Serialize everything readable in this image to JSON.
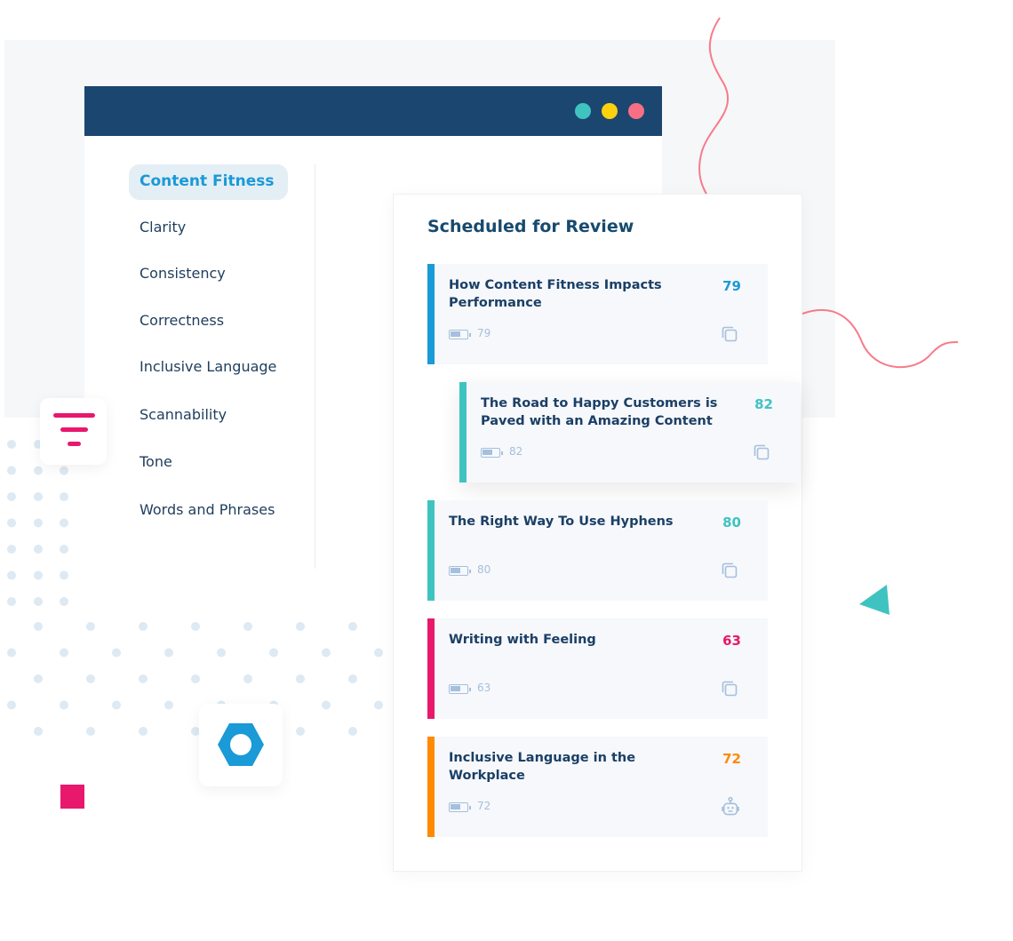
{
  "window": {
    "dots": [
      "#3fc3c1",
      "#fcd20f",
      "#f66f84"
    ]
  },
  "sidebar": {
    "items": [
      {
        "label": "Content Fitness",
        "active": true
      },
      {
        "label": "Clarity"
      },
      {
        "label": "Consistency"
      },
      {
        "label": "Correctness"
      },
      {
        "label": "Inclusive Language"
      },
      {
        "label": "Scannability"
      },
      {
        "label": "Tone"
      },
      {
        "label": "Words and Phrases"
      }
    ]
  },
  "review": {
    "title": "Scheduled for Review",
    "items": [
      {
        "title": "How Content Fitness Impacts Performance",
        "score": "79",
        "sub": "79",
        "color": "#1a9ad6",
        "icon": "copy-icon"
      },
      {
        "title": "The Road to Happy Customers is Paved with an Amazing Content",
        "score": "82",
        "sub": "82",
        "color": "#3fc3c1",
        "icon": "copy-icon"
      },
      {
        "title": "The Right Way To Use Hyphens",
        "score": "80",
        "sub": "80",
        "color": "#3fc3c1",
        "icon": "copy-icon"
      },
      {
        "title": "Writing with Feeling",
        "score": "63",
        "sub": "63",
        "color": "#e8186d",
        "icon": "copy-icon"
      },
      {
        "title": "Inclusive Language in the Workplace",
        "score": "72",
        "sub": "72",
        "color": "#ff8a00",
        "icon": "robot-icon"
      }
    ]
  }
}
